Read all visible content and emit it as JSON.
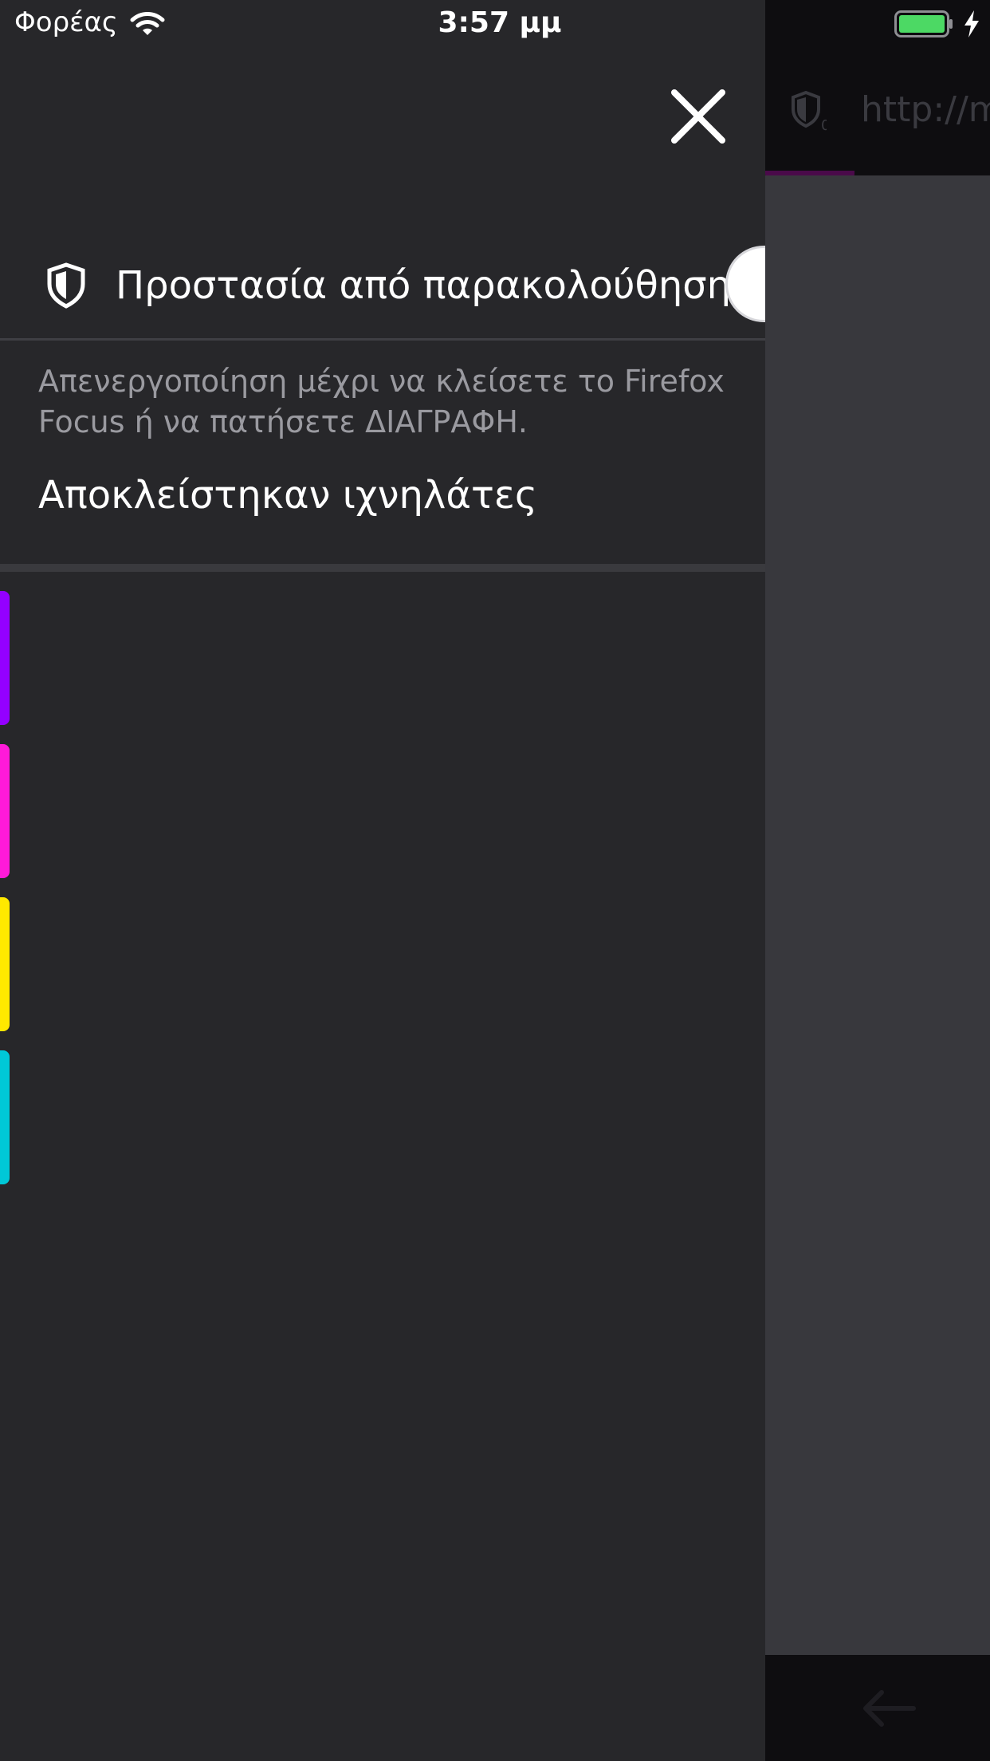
{
  "status_bar": {
    "carrier": "Φορέας",
    "time": "3:57 μμ",
    "wifi_icon": "wifi-icon",
    "battery_icon": "battery-icon",
    "charging_icon": "charging-bolt-icon",
    "battery_color": "#4cd964"
  },
  "browser": {
    "url_text": "http://m",
    "url_shield_icon": "shield-icon",
    "tracker_count": "0",
    "toolbar_icon": "back-arrow-icon"
  },
  "panel": {
    "close_icon": "close-icon",
    "tracking_protection": {
      "title": "Προστασία από παρακολούθηση",
      "icon": "shield-icon",
      "toggle_on": false,
      "description": "Απενεργοποίηση μέχρι να κλείσετε το Firefox Focus ή να πατήσετε ΔΙΑΓΡΑΦΗ."
    },
    "trackers_blocked": {
      "heading": "Αποκλείστηκαν ιχνηλάτες",
      "category_colors": [
        "#9400ff",
        "#ff1ad9",
        "#ffe900",
        "#00c8d7"
      ]
    }
  }
}
